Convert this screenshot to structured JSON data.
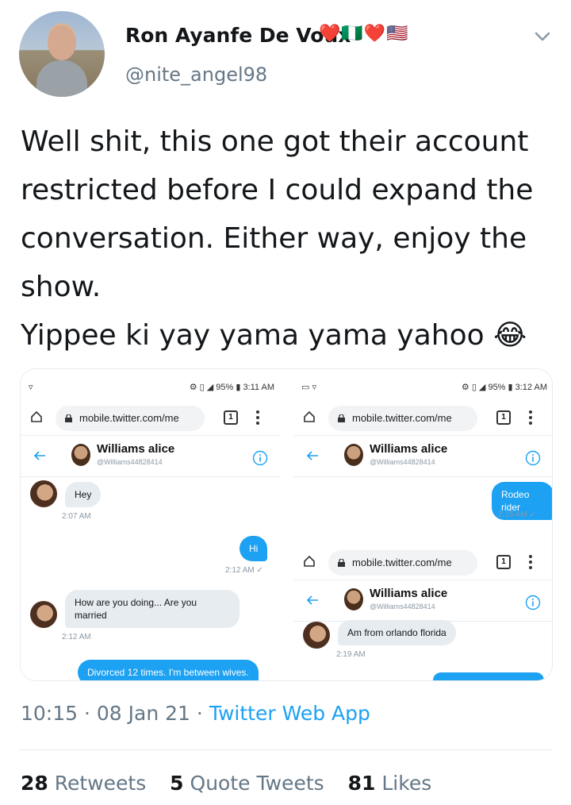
{
  "author": {
    "name": "Ron Ayanfe De Voux",
    "flags": "❤️🇳🇬❤️🇺🇸",
    "handle": "@nite_angel98"
  },
  "tweet": {
    "text": "Well shit, this one got their account restricted before I could expand the conversation. Either way, enjoy the show.\nYippee ki yay yama yama yahoo 😂"
  },
  "media": {
    "left": {
      "status_right": "⚙ ▯ ◢ 95% ▮ 3:11 AM",
      "url": "mobile.twitter.com/me",
      "tab_count": "1",
      "contact_name": "Williams alice",
      "contact_handle": "@Williams44828414",
      "messages": [
        {
          "text": "Hey",
          "time": "2:07 AM"
        },
        {
          "text": "Hi",
          "time": "2:12 AM ✓"
        },
        {
          "text": "How are you doing... Are you married",
          "time": "2:12 AM"
        },
        {
          "text": "Divorced 12 times. I'm between wives."
        }
      ]
    },
    "right_top": {
      "status_right": "⚙ ▯ ◢ 95% ▮ 3:12 AM",
      "url": "mobile.twitter.com/me",
      "tab_count": "1",
      "contact_name": "Williams alice",
      "contact_handle": "@Williams44828414",
      "messages": [
        {
          "text": "Rodeo rider",
          "time": "2:15 AM ✓"
        }
      ]
    },
    "right_bottom": {
      "url": "mobile.twitter.com/me",
      "tab_count": "1",
      "contact_name": "Williams alice",
      "contact_handle": "@Williams44828414",
      "messages": [
        {
          "text": "Am from orlando florida",
          "time": "2:19 AM"
        }
      ]
    }
  },
  "meta": {
    "time": "10:15",
    "date": "08 Jan 21",
    "source": "Twitter Web App"
  },
  "stats": {
    "retweets_count": "28",
    "retweets_label": "Retweets",
    "quotes_count": "5",
    "quotes_label": "Quote Tweets",
    "likes_count": "81",
    "likes_label": "Likes"
  },
  "colors": {
    "accent": "#1da1f2",
    "secondary_text": "#657786"
  }
}
